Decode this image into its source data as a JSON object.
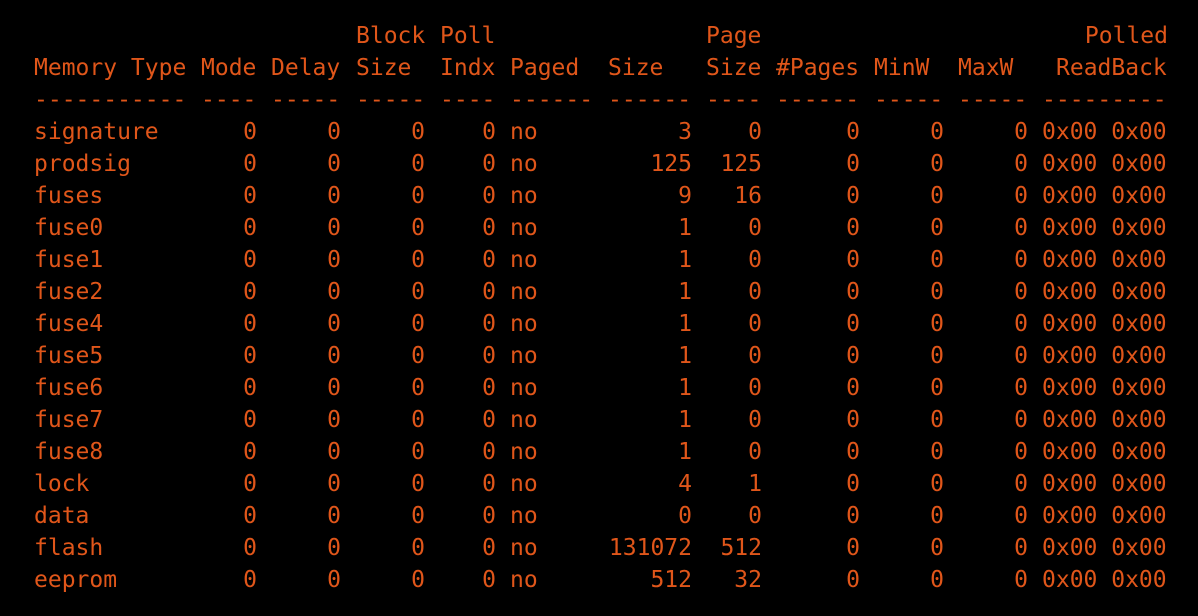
{
  "colors": {
    "background": "#000000",
    "text": "#e0561a"
  },
  "header": {
    "line1": {
      "block": "Block",
      "poll": "Poll",
      "page": "Page",
      "polled": "Polled"
    },
    "line2": {
      "memory_type": "Memory Type",
      "mode": "Mode",
      "delay": "Delay",
      "block_size": "Size",
      "poll_indx": "Indx",
      "paged": "Paged",
      "size": "Size",
      "page_size": "Size",
      "pages": "#Pages",
      "minw": "MinW",
      "maxw": "MaxW",
      "readback": "ReadBack"
    },
    "dashes": {
      "memory_type": "-----------",
      "mode": "----",
      "delay": "-----",
      "block_size": "-----",
      "poll_indx": "----",
      "paged": "------",
      "size": "------",
      "page_size": "----",
      "pages": "------",
      "minw": "-----",
      "maxw": "-----",
      "readback": "---------"
    }
  },
  "rows": [
    {
      "name": "signature",
      "mode": "0",
      "delay": "0",
      "block": "0",
      "poll": "0",
      "paged": "no",
      "size": "3",
      "page": "0",
      "pages": "0",
      "minw": "0",
      "maxw": "0",
      "readback": "0x00 0x00"
    },
    {
      "name": "prodsig",
      "mode": "0",
      "delay": "0",
      "block": "0",
      "poll": "0",
      "paged": "no",
      "size": "125",
      "page": "125",
      "pages": "0",
      "minw": "0",
      "maxw": "0",
      "readback": "0x00 0x00"
    },
    {
      "name": "fuses",
      "mode": "0",
      "delay": "0",
      "block": "0",
      "poll": "0",
      "paged": "no",
      "size": "9",
      "page": "16",
      "pages": "0",
      "minw": "0",
      "maxw": "0",
      "readback": "0x00 0x00"
    },
    {
      "name": "fuse0",
      "mode": "0",
      "delay": "0",
      "block": "0",
      "poll": "0",
      "paged": "no",
      "size": "1",
      "page": "0",
      "pages": "0",
      "minw": "0",
      "maxw": "0",
      "readback": "0x00 0x00"
    },
    {
      "name": "fuse1",
      "mode": "0",
      "delay": "0",
      "block": "0",
      "poll": "0",
      "paged": "no",
      "size": "1",
      "page": "0",
      "pages": "0",
      "minw": "0",
      "maxw": "0",
      "readback": "0x00 0x00"
    },
    {
      "name": "fuse2",
      "mode": "0",
      "delay": "0",
      "block": "0",
      "poll": "0",
      "paged": "no",
      "size": "1",
      "page": "0",
      "pages": "0",
      "minw": "0",
      "maxw": "0",
      "readback": "0x00 0x00"
    },
    {
      "name": "fuse4",
      "mode": "0",
      "delay": "0",
      "block": "0",
      "poll": "0",
      "paged": "no",
      "size": "1",
      "page": "0",
      "pages": "0",
      "minw": "0",
      "maxw": "0",
      "readback": "0x00 0x00"
    },
    {
      "name": "fuse5",
      "mode": "0",
      "delay": "0",
      "block": "0",
      "poll": "0",
      "paged": "no",
      "size": "1",
      "page": "0",
      "pages": "0",
      "minw": "0",
      "maxw": "0",
      "readback": "0x00 0x00"
    },
    {
      "name": "fuse6",
      "mode": "0",
      "delay": "0",
      "block": "0",
      "poll": "0",
      "paged": "no",
      "size": "1",
      "page": "0",
      "pages": "0",
      "minw": "0",
      "maxw": "0",
      "readback": "0x00 0x00"
    },
    {
      "name": "fuse7",
      "mode": "0",
      "delay": "0",
      "block": "0",
      "poll": "0",
      "paged": "no",
      "size": "1",
      "page": "0",
      "pages": "0",
      "minw": "0",
      "maxw": "0",
      "readback": "0x00 0x00"
    },
    {
      "name": "fuse8",
      "mode": "0",
      "delay": "0",
      "block": "0",
      "poll": "0",
      "paged": "no",
      "size": "1",
      "page": "0",
      "pages": "0",
      "minw": "0",
      "maxw": "0",
      "readback": "0x00 0x00"
    },
    {
      "name": "lock",
      "mode": "0",
      "delay": "0",
      "block": "0",
      "poll": "0",
      "paged": "no",
      "size": "4",
      "page": "1",
      "pages": "0",
      "minw": "0",
      "maxw": "0",
      "readback": "0x00 0x00"
    },
    {
      "name": "data",
      "mode": "0",
      "delay": "0",
      "block": "0",
      "poll": "0",
      "paged": "no",
      "size": "0",
      "page": "0",
      "pages": "0",
      "minw": "0",
      "maxw": "0",
      "readback": "0x00 0x00"
    },
    {
      "name": "flash",
      "mode": "0",
      "delay": "0",
      "block": "0",
      "poll": "0",
      "paged": "no",
      "size": "131072",
      "page": "512",
      "pages": "0",
      "minw": "0",
      "maxw": "0",
      "readback": "0x00 0x00"
    },
    {
      "name": "eeprom",
      "mode": "0",
      "delay": "0",
      "block": "0",
      "poll": "0",
      "paged": "no",
      "size": "512",
      "page": "32",
      "pages": "0",
      "minw": "0",
      "maxw": "0",
      "readback": "0x00 0x00"
    }
  ]
}
